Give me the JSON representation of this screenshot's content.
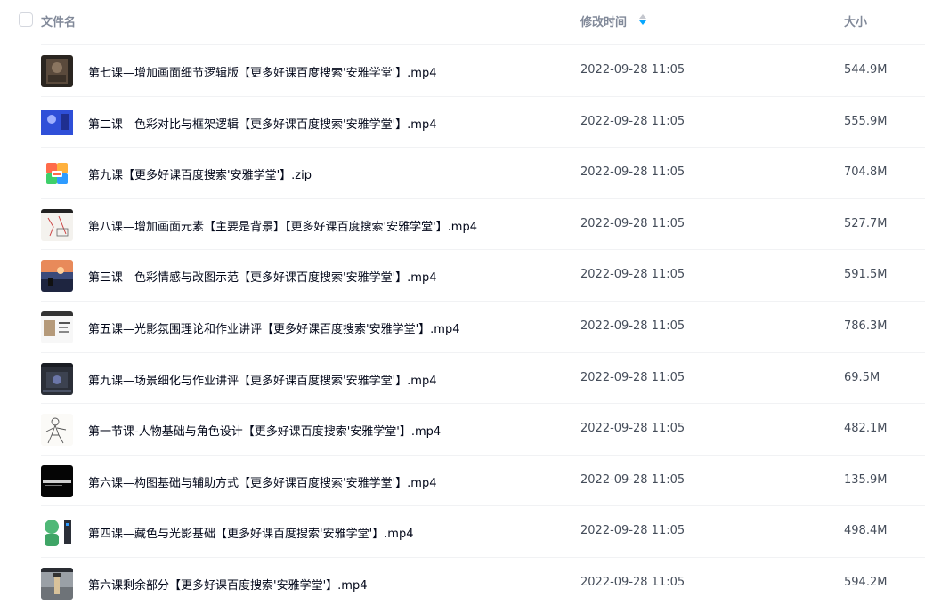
{
  "header": {
    "name_label": "文件名",
    "time_label": "修改时间",
    "size_label": "大小"
  },
  "files": [
    {
      "name": "第七课—增加画面细节逻辑版【更多好课百度搜索'安雅学堂'】.mp4",
      "time": "2022-09-28 11:05",
      "size": "544.9M",
      "thumb": "video-thumbnail-dark-photo"
    },
    {
      "name": "第二课—色彩对比与框架逻辑【更多好课百度搜索'安雅学堂'】.mp4",
      "time": "2022-09-28 11:05",
      "size": "555.9M",
      "thumb": "video-thumbnail-blue-slide"
    },
    {
      "name": "第九课【更多好课百度搜索'安雅学堂'】.zip",
      "time": "2022-09-28 11:05",
      "size": "704.8M",
      "thumb": "zip-archive-icon"
    },
    {
      "name": "第八课—增加画面元素【主要是背景】【更多好课百度搜索'安雅学堂'】.mp4",
      "time": "2022-09-28 11:05",
      "size": "527.7M",
      "thumb": "video-thumbnail-sketch"
    },
    {
      "name": "第三课—色彩情感与改图示范【更多好课百度搜索'安雅学堂'】.mp4",
      "time": "2022-09-28 11:05",
      "size": "591.5M",
      "thumb": "video-thumbnail-sunset"
    },
    {
      "name": "第五课—光影氛围理论和作业讲评【更多好课百度搜索'安雅学堂'】.mp4",
      "time": "2022-09-28 11:05",
      "size": "786.3M",
      "thumb": "video-thumbnail-slide"
    },
    {
      "name": "第九课—场景细化与作业讲评【更多好课百度搜索'安雅学堂'】.mp4",
      "time": "2022-09-28 11:05",
      "size": "69.5M",
      "thumb": "video-thumbnail-software"
    },
    {
      "name": "第一节课-人物基础与角色设计【更多好课百度搜索'安雅学堂'】.mp4",
      "time": "2022-09-28 11:05",
      "size": "482.1M",
      "thumb": "video-thumbnail-character-sketch"
    },
    {
      "name": "第六课—构图基础与辅助方式【更多好课百度搜索'安雅学堂'】.mp4",
      "time": "2022-09-28 11:05",
      "size": "135.9M",
      "thumb": "video-thumbnail-black-title"
    },
    {
      "name": "第四课—藏色与光影基础【更多好课百度搜索'安雅学堂'】.mp4",
      "time": "2022-09-28 11:05",
      "size": "498.4M",
      "thumb": "video-thumbnail-green-shapes"
    },
    {
      "name": "第六课剩余部分【更多好课百度搜索'安雅学堂'】.mp4",
      "time": "2022-09-28 11:05",
      "size": "594.2M",
      "thumb": "video-thumbnail-scene"
    }
  ],
  "colors": {
    "sort_up": "#c4c7ce",
    "sort_down": "#06a7ff",
    "header_text": "#818999",
    "row_text": "#03081a",
    "meta_text": "#454d5a"
  }
}
